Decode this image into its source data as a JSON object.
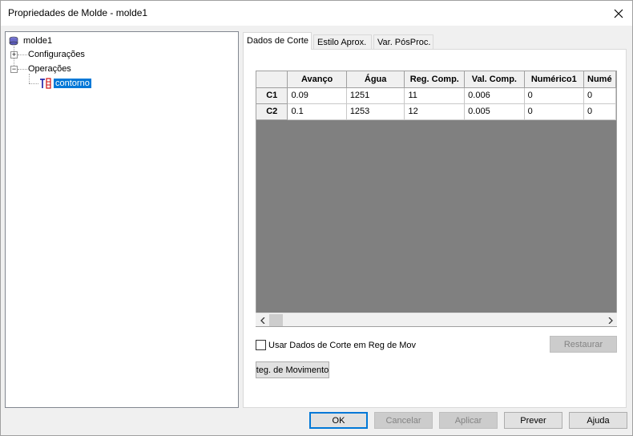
{
  "window": {
    "title": "Propriedades de Molde - molde1"
  },
  "tree": {
    "root": "molde1",
    "items": [
      {
        "label": "Configurações",
        "expander": "+"
      },
      {
        "label": "Operações",
        "expander": "−"
      }
    ],
    "child": "contorno"
  },
  "tabs": [
    {
      "label": "Dados de Corte"
    },
    {
      "label": "Estilo Aprox."
    },
    {
      "label": "Var. PósProc."
    }
  ],
  "grid": {
    "columns": [
      "Avanço",
      "Água",
      "Reg. Comp.",
      "Val. Comp.",
      "Numérico1",
      "Numé"
    ],
    "rows": [
      {
        "header": "C1",
        "cells": [
          "0.09",
          "1251",
          "11",
          "0.006",
          "0",
          "0"
        ]
      },
      {
        "header": "C2",
        "cells": [
          "0.1",
          "1253",
          "12",
          "0.005",
          "0",
          "0"
        ]
      }
    ]
  },
  "checkbox": {
    "label": "Usar Dados de Corte em Reg de Mov",
    "checked": false
  },
  "restore_button": "Restaurar",
  "reg_button": "teg. de Movimento",
  "buttons": {
    "ok": "OK",
    "cancel": "Cancelar",
    "apply": "Aplicar",
    "preview": "Prever",
    "help": "Ajuda"
  }
}
